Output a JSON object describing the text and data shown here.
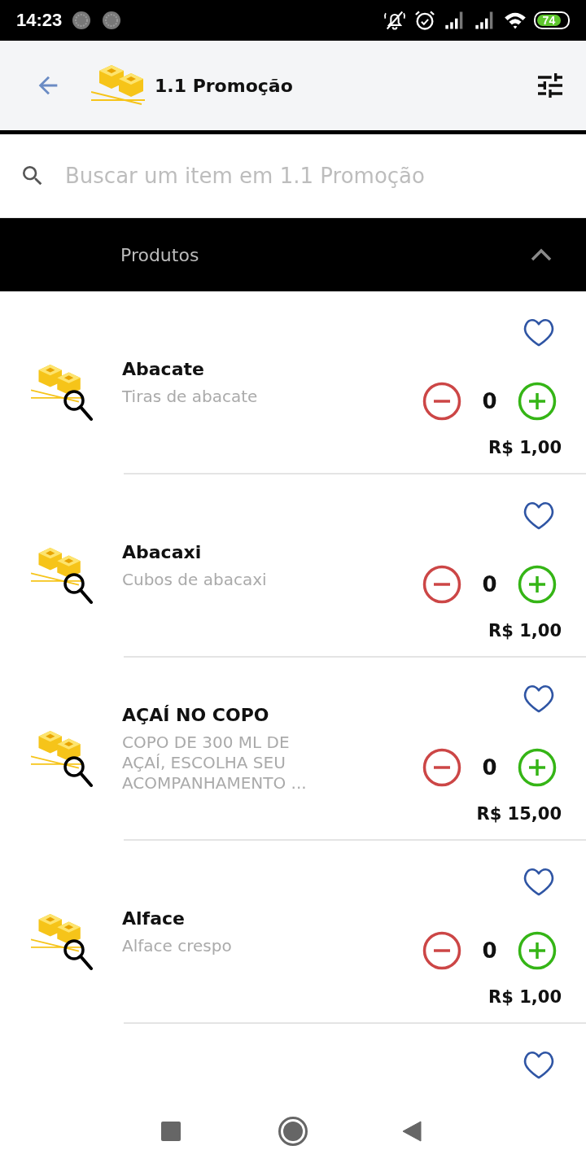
{
  "status_bar": {
    "time": "14:23",
    "battery": "74"
  },
  "header": {
    "title": "1.1 Promoção"
  },
  "search": {
    "placeholder": "Buscar um item em 1.1 Promoção"
  },
  "section": {
    "title": "Produtos",
    "expanded": true
  },
  "products": [
    {
      "name": "Abacate",
      "description": "Tiras de abacate",
      "quantity": "0",
      "price": "R$ 1,00",
      "favorite": false
    },
    {
      "name": "Abacaxi",
      "description": "Cubos de abacaxi",
      "quantity": "0",
      "price": "R$ 1,00",
      "favorite": false
    },
    {
      "name": "AÇAÍ NO COPO",
      "description": "COPO DE 300 ML DE AÇAÍ, ESCOLHA SEU ACOMPANHAMENTO ...",
      "quantity": "0",
      "price": "R$ 15,00",
      "favorite": false
    },
    {
      "name": "Alface",
      "description": "Alface crespo",
      "quantity": "0",
      "price": "R$ 1,00",
      "favorite": false
    },
    {
      "favorite": false
    }
  ]
}
